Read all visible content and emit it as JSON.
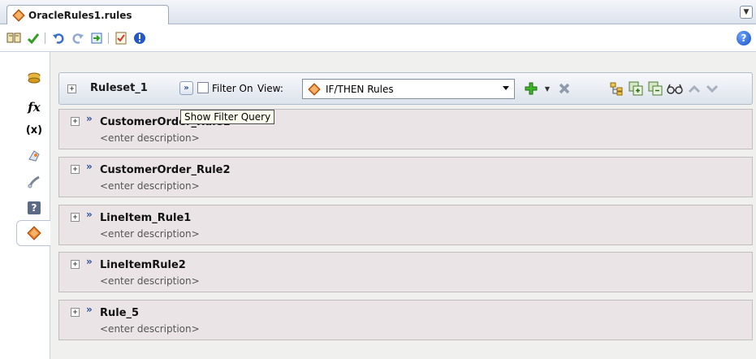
{
  "tab": {
    "title": "OracleRules1.rules",
    "dropdown_icon": "chevron-down-icon"
  },
  "toolbar": {
    "icons": [
      "book-icon",
      "check-icon",
      "undo-icon",
      "redo-icon",
      "import-icon",
      "validate-icon",
      "info-icon"
    ],
    "help_label": "?"
  },
  "sidenav": {
    "items": [
      {
        "icon": "facts-icon"
      },
      {
        "icon": "functions-icon",
        "label": "fx"
      },
      {
        "icon": "variables-icon",
        "label": "(x)"
      },
      {
        "icon": "globals-icon"
      },
      {
        "icon": "links-icon"
      },
      {
        "icon": "decision-functions-icon",
        "label": "?"
      },
      {
        "icon": "rulesets-icon"
      }
    ]
  },
  "ruleset": {
    "name": "Ruleset_1",
    "expand_symbol": "+",
    "filter_query_symbol": "»",
    "filter_label": "Filter On",
    "filter_checked": false,
    "view_label": "View:",
    "view_value": "IF/THEN Rules",
    "tooltip": "Show Filter Query",
    "action_icons": [
      "add-icon",
      "add-menu-arrow",
      "delete-icon",
      "hierarchy-icon",
      "expand-all-icon",
      "collapse-all-icon",
      "glasses-icon",
      "move-up-icon",
      "move-down-icon"
    ]
  },
  "rules": [
    {
      "name": "CustomerOrder_Rule1",
      "description": "<enter description>",
      "expand": "+",
      "chev": "»"
    },
    {
      "name": "CustomerOrder_Rule2",
      "description": "<enter description>",
      "expand": "+",
      "chev": "»"
    },
    {
      "name": "LineItem_Rule1",
      "description": "<enter description>",
      "expand": "+",
      "chev": "»"
    },
    {
      "name": "LineItemRule2",
      "description": "<enter description>",
      "expand": "+",
      "chev": "»"
    },
    {
      "name": "Rule_5",
      "description": "<enter description>",
      "expand": "+",
      "chev": "»"
    }
  ],
  "colors": {
    "accent_orange": "#e8822c",
    "add_green": "#2f9e1f",
    "rule_bg": "#ebe4e6"
  }
}
